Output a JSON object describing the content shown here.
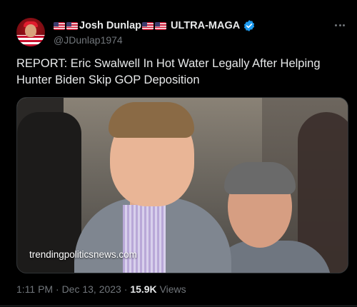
{
  "author": {
    "display_name_part1": "Josh Dunlap",
    "display_name_part2": "ULTRA-MAGA",
    "handle": "@JDunlap1974",
    "verified": true,
    "flag_icon": "us-flag-icon"
  },
  "tweet": {
    "text": "REPORT: Eric Swalwell In Hot Water Legally After Helping Hunter Biden Skip GOP Deposition",
    "media": {
      "watermark": "trendingpoliticsnews.com"
    }
  },
  "meta": {
    "time": "1:11 PM",
    "separator1": "·",
    "date": "Dec 13, 2023",
    "separator2": "·",
    "views_count": "15.9K",
    "views_label": "Views"
  },
  "colors": {
    "background": "#000000",
    "text": "#e7e9ea",
    "secondary": "#71767b",
    "verified": "#1d9bf0"
  }
}
